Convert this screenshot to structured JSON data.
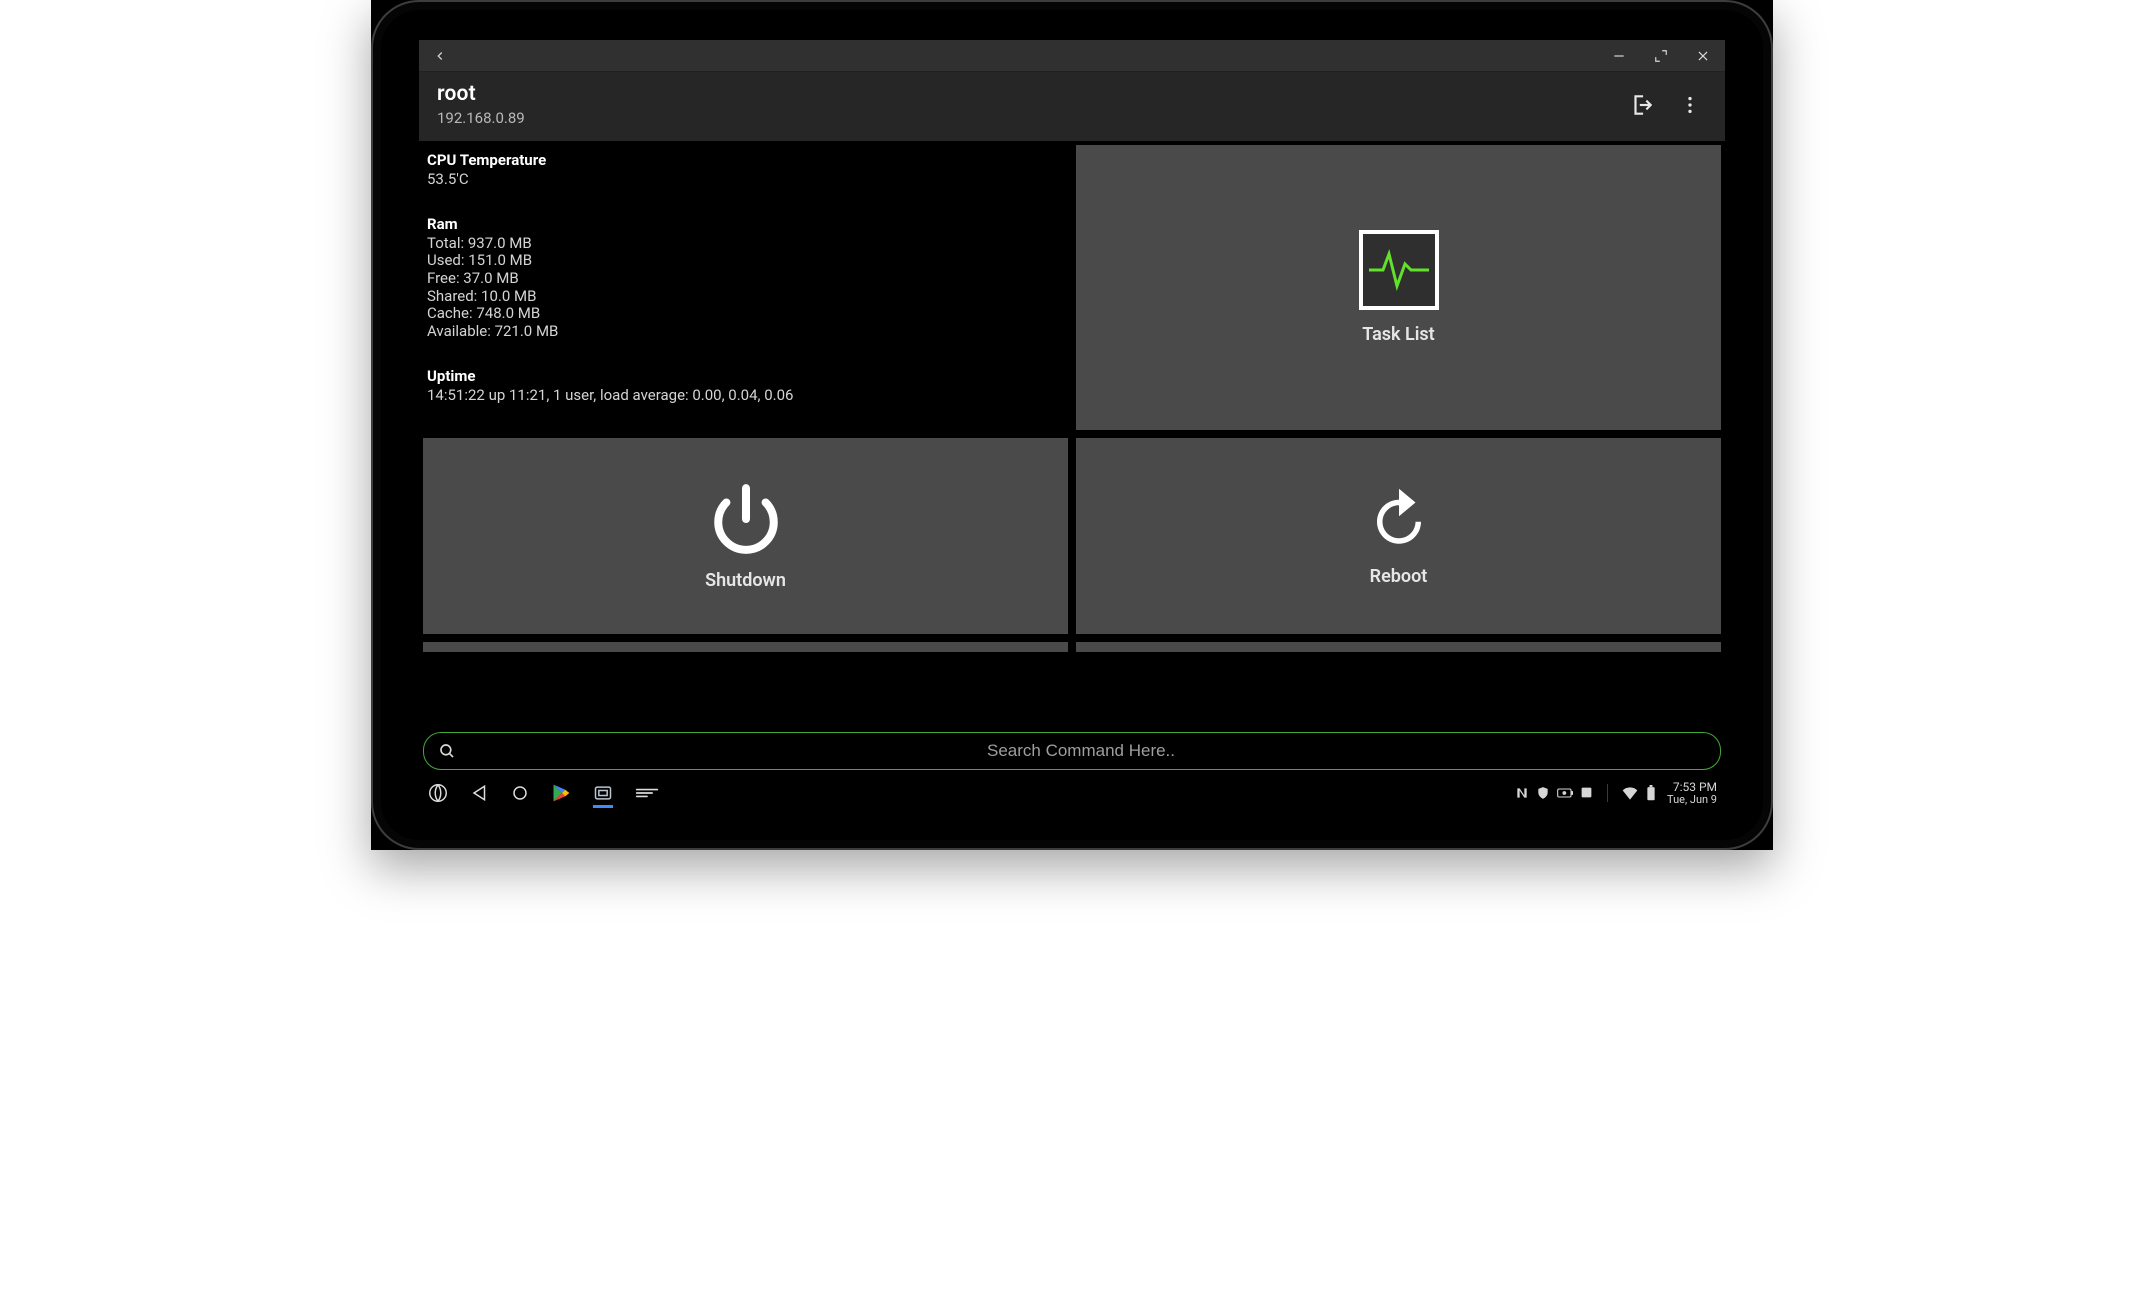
{
  "window": {
    "title": "root",
    "subtitle": "192.168.0.89"
  },
  "info": {
    "cpu_temp_heading": "CPU Temperature",
    "cpu_temp_value": "53.5'C",
    "ram_heading": "Ram",
    "ram_total": "Total: 937.0 MB",
    "ram_used": "Used: 151.0 MB",
    "ram_free": "Free: 37.0 MB",
    "ram_shared": "Shared: 10.0 MB",
    "ram_cache": "Cache: 748.0 MB",
    "ram_available": "Available: 721.0 MB",
    "uptime_heading": "Uptime",
    "uptime_value": " 14:51:22 up 11:21,  1 user,  load average: 0.00, 0.04, 0.06"
  },
  "tiles": {
    "task_list": "Task List",
    "shutdown": "Shutdown",
    "reboot": "Reboot"
  },
  "search": {
    "placeholder": "Search Command Here.."
  },
  "taskbar": {
    "time": "7:53 PM",
    "date": "Tue, Jun 9"
  },
  "colors": {
    "accent_green": "#56c12f",
    "tile_grey": "#4a4a4a",
    "header_grey": "#262626"
  }
}
